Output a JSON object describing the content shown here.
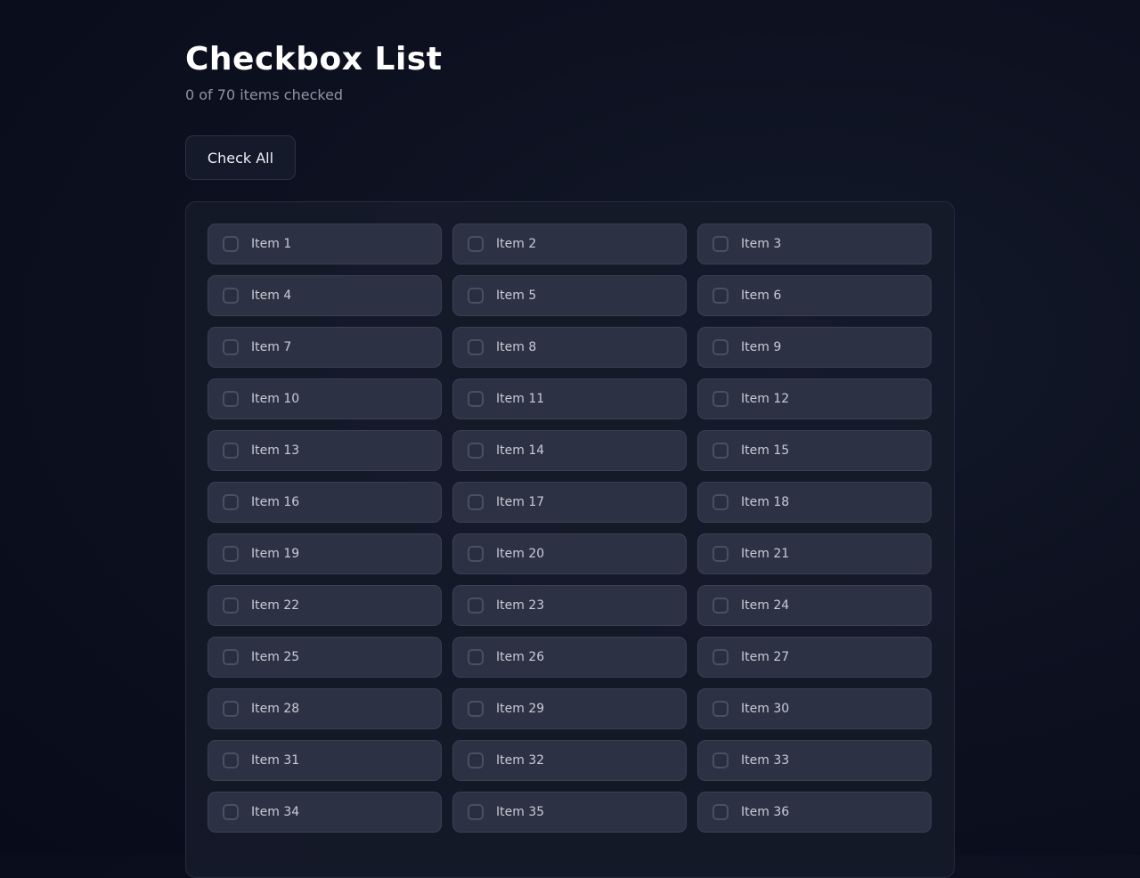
{
  "header": {
    "title": "Checkbox List",
    "status": "0 of 70 items checked"
  },
  "toolbar": {
    "check_all_label": "Check All"
  },
  "colors": {
    "background": "#0b0f1e",
    "panel": "#161b2a",
    "item": "#2c3143",
    "item_border": "#3a3f52",
    "text": "#c9ccd6",
    "muted": "#8e94a7"
  },
  "checklist": {
    "total": 70,
    "checked_count": 0,
    "items": [
      {
        "label": "Item 1",
        "checked": false
      },
      {
        "label": "Item 2",
        "checked": false
      },
      {
        "label": "Item 3",
        "checked": false
      },
      {
        "label": "Item 4",
        "checked": false
      },
      {
        "label": "Item 5",
        "checked": false
      },
      {
        "label": "Item 6",
        "checked": false
      },
      {
        "label": "Item 7",
        "checked": false
      },
      {
        "label": "Item 8",
        "checked": false
      },
      {
        "label": "Item 9",
        "checked": false
      },
      {
        "label": "Item 10",
        "checked": false
      },
      {
        "label": "Item 11",
        "checked": false
      },
      {
        "label": "Item 12",
        "checked": false
      },
      {
        "label": "Item 13",
        "checked": false
      },
      {
        "label": "Item 14",
        "checked": false
      },
      {
        "label": "Item 15",
        "checked": false
      },
      {
        "label": "Item 16",
        "checked": false
      },
      {
        "label": "Item 17",
        "checked": false
      },
      {
        "label": "Item 18",
        "checked": false
      },
      {
        "label": "Item 19",
        "checked": false
      },
      {
        "label": "Item 20",
        "checked": false
      },
      {
        "label": "Item 21",
        "checked": false
      },
      {
        "label": "Item 22",
        "checked": false
      },
      {
        "label": "Item 23",
        "checked": false
      },
      {
        "label": "Item 24",
        "checked": false
      },
      {
        "label": "Item 25",
        "checked": false
      },
      {
        "label": "Item 26",
        "checked": false
      },
      {
        "label": "Item 27",
        "checked": false
      },
      {
        "label": "Item 28",
        "checked": false
      },
      {
        "label": "Item 29",
        "checked": false
      },
      {
        "label": "Item 30",
        "checked": false
      },
      {
        "label": "Item 31",
        "checked": false
      },
      {
        "label": "Item 32",
        "checked": false
      },
      {
        "label": "Item 33",
        "checked": false
      },
      {
        "label": "Item 34",
        "checked": false
      },
      {
        "label": "Item 35",
        "checked": false
      },
      {
        "label": "Item 36",
        "checked": false
      }
    ]
  }
}
